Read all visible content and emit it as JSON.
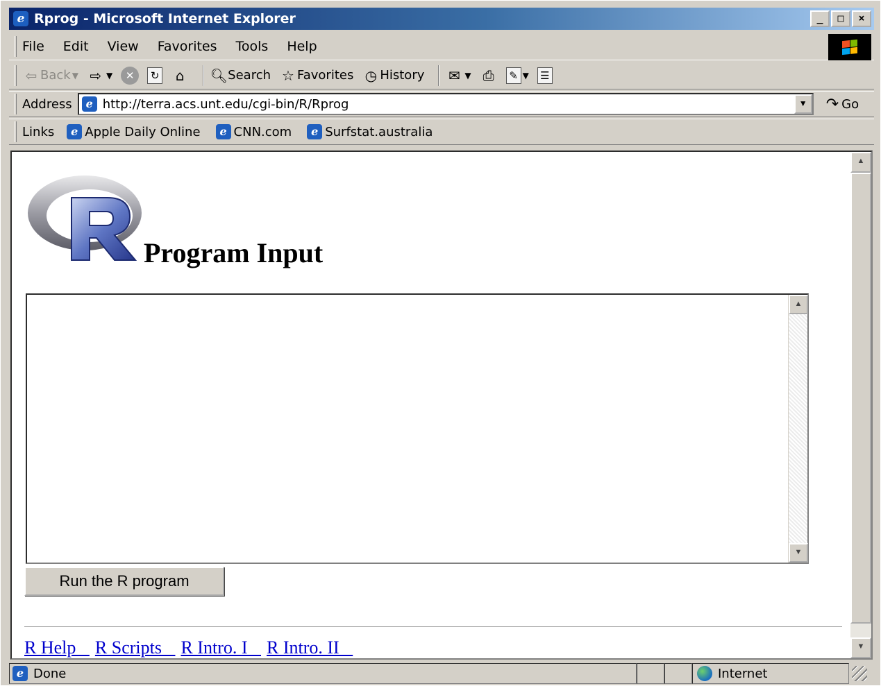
{
  "window": {
    "title": "Rprog - Microsoft Internet Explorer",
    "controls": {
      "minimize": "_",
      "maximize": "□",
      "close": "×"
    }
  },
  "menu": [
    "File",
    "Edit",
    "View",
    "Favorites",
    "Tools",
    "Help"
  ],
  "toolbar": {
    "back": "Back",
    "search": "Search",
    "favorites": "Favorites",
    "history": "History"
  },
  "address": {
    "label": "Address",
    "url": "http://terra.acs.unt.edu/cgi-bin/R/Rprog",
    "go": "Go"
  },
  "links": {
    "label": "Links",
    "items": [
      "Apple Daily Online",
      "CNN.com",
      "Surfstat.australia"
    ]
  },
  "page": {
    "heading": "Program Input",
    "code_value": "",
    "run_button": "Run the R program",
    "footer_links": [
      "R Help   ",
      "R Scripts   ",
      "R Intro. I   ",
      "R Intro. II   "
    ]
  },
  "status": {
    "text": "Done",
    "zone": "Internet"
  },
  "colors": {
    "title_gradient_start": "#0a246a",
    "title_gradient_end": "#a6caf0",
    "link": "#0000cc",
    "chrome": "#d4d0c8"
  }
}
